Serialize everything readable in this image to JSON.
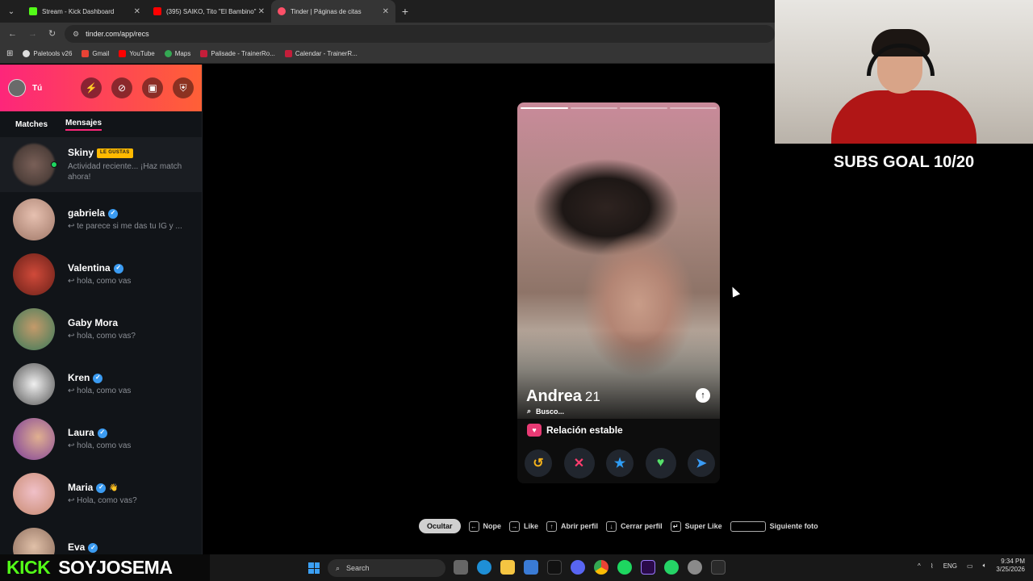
{
  "browser": {
    "tabs": [
      {
        "label": "Stream - Kick Dashboard",
        "color": "#53fc18"
      },
      {
        "label": "(395) SAIKO, Tito \"El Bambino\"",
        "color": "#ff0000"
      },
      {
        "label": "Tinder | Páginas de citas",
        "color": "#fd5068"
      }
    ],
    "url": "tinder.com/app/recs",
    "bookmarks": [
      {
        "label": "Paletools v26",
        "color": "#dddddd"
      },
      {
        "label": "Gmail",
        "color": "#ea4335"
      },
      {
        "label": "YouTube",
        "color": "#ff0000"
      },
      {
        "label": "Maps",
        "color": "#34a853"
      },
      {
        "label": "Palisade - TrainerRo...",
        "color": "#c41e3a"
      },
      {
        "label": "Calendar - TrainerR...",
        "color": "#c41e3a"
      }
    ]
  },
  "sidebar": {
    "you_label": "Tú",
    "tabs": [
      "Matches",
      "Mensajes"
    ],
    "active_tab": "Mensajes",
    "messages": [
      {
        "name": "Skiny",
        "badge": "LE GUSTAS",
        "preview": "Actividad reciente... ¡Haz match ahora!",
        "verified": false,
        "online": true,
        "avatar_color": "#5a4a44"
      },
      {
        "name": "gabriela",
        "preview": "↩ te parece si me das tu IG y ...",
        "verified": true,
        "avatar_color": "#c99a8a"
      },
      {
        "name": "Valentina",
        "preview": "↩ hola, como vas",
        "verified": true,
        "avatar_color": "#b23a2a"
      },
      {
        "name": "Gaby Mora",
        "preview": "↩ hola, como vas?",
        "verified": false,
        "avatar_color": "#9a7a5a"
      },
      {
        "name": "Kren",
        "preview": "↩ hola, como vas",
        "verified": true,
        "avatar_color": "#cfcfcf"
      },
      {
        "name": "Laura",
        "preview": "↩ hola, como vas",
        "verified": true,
        "avatar_color": "#a05ab0"
      },
      {
        "name": "Maria",
        "preview": "↩ Hola, como vas?",
        "verified": true,
        "emoji": "👋",
        "avatar_color": "#d6a0b0"
      },
      {
        "name": "Eva",
        "preview": "",
        "verified": true,
        "avatar_color": "#c0a090"
      }
    ]
  },
  "card": {
    "name": "Andrea",
    "age": "21",
    "busco_label": "Busco...",
    "relationship": "Relación estable",
    "photo_count": 4,
    "active_photo": 0
  },
  "actions": [
    {
      "name": "rewind",
      "glyph": "↺",
      "color": "#f5b21b"
    },
    {
      "name": "nope",
      "glyph": "✕",
      "color": "#ff3d6e"
    },
    {
      "name": "super-like",
      "glyph": "★",
      "color": "#2f9df5"
    },
    {
      "name": "like",
      "glyph": "♥",
      "color": "#56e06a"
    },
    {
      "name": "boost",
      "glyph": "➤",
      "color": "#3a9bf5"
    }
  ],
  "shortcuts": {
    "hide": "Ocultar",
    "items": [
      {
        "key": "←",
        "label": "Nope"
      },
      {
        "key": "→",
        "label": "Like"
      },
      {
        "key": "↑",
        "label": "Abrir perfil"
      },
      {
        "key": "↓",
        "label": "Cerrar perfil"
      },
      {
        "key": "↵",
        "label": "Super Like"
      },
      {
        "key": "",
        "label": "Siguiente foto"
      }
    ]
  },
  "overlay": {
    "subs_goal": "SUBS GOAL 10/20",
    "kick_logo": "KICK",
    "username": "SOYJOSEMA"
  },
  "taskbar": {
    "search_placeholder": "Search",
    "language": "ENG",
    "time": "9:34 PM",
    "date": "3/25/2026"
  }
}
